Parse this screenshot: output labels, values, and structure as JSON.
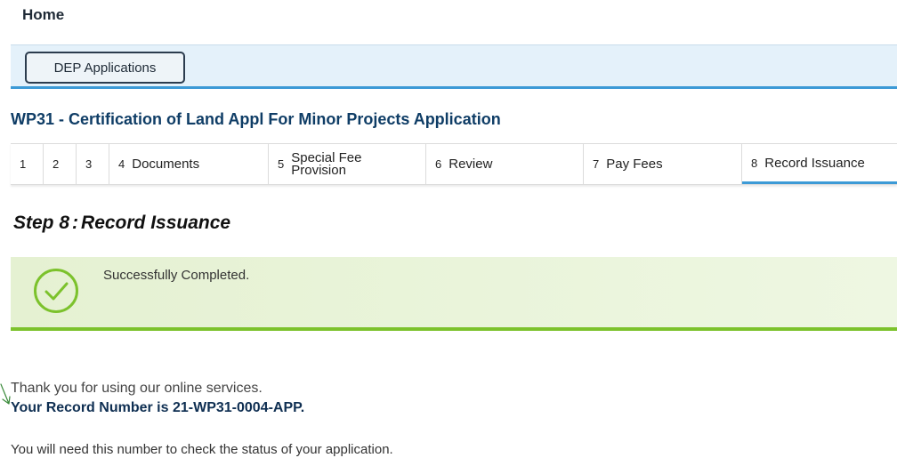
{
  "header": {
    "home_label": "Home"
  },
  "app_bar": {
    "dep_button_label": "DEP Applications"
  },
  "page": {
    "title": "WP31 - Certification of Land Appl For Minor Projects Application"
  },
  "steps": [
    {
      "num": "1",
      "label": ""
    },
    {
      "num": "2",
      "label": ""
    },
    {
      "num": "3",
      "label": ""
    },
    {
      "num": "4",
      "label": "Documents"
    },
    {
      "num": "5",
      "label_line1": "Special Fee",
      "label_line2": "Provision"
    },
    {
      "num": "6",
      "label": "Review"
    },
    {
      "num": "7",
      "label": "Pay Fees"
    },
    {
      "num": "8",
      "label": "Record Issuance",
      "active": true
    }
  ],
  "step_heading": {
    "step": "Step 8",
    "colon": ":",
    "name": "Record Issuance"
  },
  "success": {
    "message": "Successfully Completed.",
    "icon": "check-circle-icon",
    "color": "#7cc22c"
  },
  "confirmation": {
    "thanks": "Thank you for using our online services.",
    "record_number_text": "Your Record Number is 21-WP31-0004-APP.",
    "status_note": "You will need this number to check the status of your application."
  },
  "colors": {
    "accent_blue": "#3c9ad6",
    "title_blue": "#0f3d66",
    "success_green": "#7cc22c"
  }
}
